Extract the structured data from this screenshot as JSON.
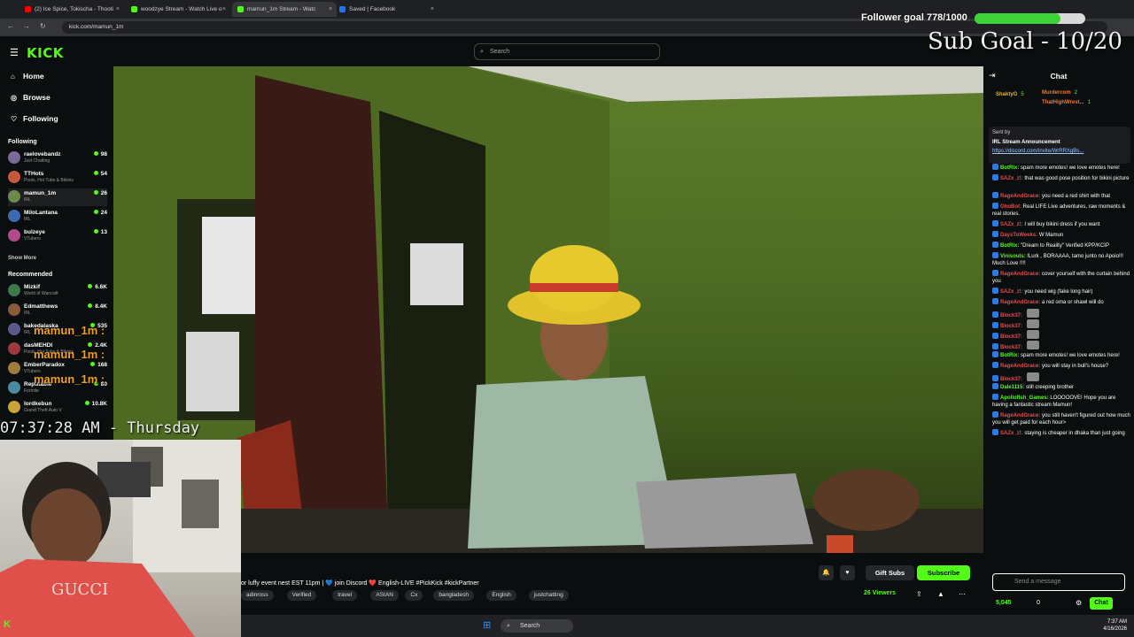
{
  "browser": {
    "tabs": [
      {
        "label": "(2) Ice Spice, Tokischa - Thooti",
        "color": "#ff0000",
        "active": false
      },
      {
        "label": "woodzye Stream - Watch Live o",
        "color": "#53fc18",
        "active": false
      },
      {
        "label": "mamun_1m Stream - Watc",
        "color": "#53fc18",
        "active": true
      },
      {
        "label": "Saved | Facebook",
        "color": "#1877f2",
        "active": false
      }
    ],
    "url": "kick.com/mamun_1m"
  },
  "header": {
    "logo": "KICK",
    "search_placeholder": "Search"
  },
  "sidebar": {
    "nav": [
      {
        "label": "Home",
        "icon": "home-icon"
      },
      {
        "label": "Browse",
        "icon": "compass-icon"
      },
      {
        "label": "Following",
        "icon": "heart-icon"
      }
    ],
    "following_title": "Following",
    "following": [
      {
        "name": "raelovebandz",
        "category": "Just Chatting",
        "viewers": "98",
        "color": "#7a6a9a"
      },
      {
        "name": "TTHots",
        "category": "Pools, Hot Tubs & Bikinis",
        "viewers": "54",
        "color": "#c45a3a"
      },
      {
        "name": "mamun_1m",
        "category": "IRL",
        "viewers": "26",
        "color": "#6b8a4a"
      },
      {
        "name": "MiloLantana",
        "category": "IRL",
        "viewers": "24",
        "color": "#3a6ab0"
      },
      {
        "name": "bulzeye",
        "category": "VTubers",
        "viewers": "13",
        "color": "#b04a8a"
      }
    ],
    "show_more": "Show More",
    "recommended_title": "Recommended",
    "recommended": [
      {
        "name": "Mizkif",
        "category": "World of Warcraft",
        "viewers": "6.6K",
        "color": "#3a7a4a"
      },
      {
        "name": "Edmatthews",
        "category": "IRL",
        "viewers": "8.4K",
        "color": "#8a5a3a"
      },
      {
        "name": "bakedalaska",
        "category": "IRL",
        "viewers": "535",
        "color": "#5a5a8a"
      },
      {
        "name": "dasMEHDI",
        "category": "Pools, Hot Tubs & Bikinis",
        "viewers": "2.4K",
        "color": "#9a3a3a"
      },
      {
        "name": "EmberParadox",
        "category": "VTubers",
        "viewers": "168",
        "color": "#a07a3a"
      },
      {
        "name": "Reputable",
        "category": "Fortnite",
        "viewers": "80",
        "color": "#4a8aa0"
      },
      {
        "name": "lordkebun",
        "category": "Grand Theft Auto V",
        "viewers": "10.8K",
        "color": "#c8a23a"
      }
    ]
  },
  "overlay": {
    "follower_goal": "Follower goal 778/1000",
    "follower_progress": 0.778,
    "sub_goal": "Sub Goal - 10/20",
    "clock": "07:37:28 AM - Thursday",
    "names": [
      "mamun_1m :",
      "mamun_1m :",
      "mamun_1m :"
    ]
  },
  "stream": {
    "title": "or luffy event nest EST 11pm | 💙 join Discord ❤️ English-LIVE #PickKick #kickPartner",
    "tags": [
      "adinross",
      "Verified",
      "travel",
      "ASIAN",
      "Cx",
      "bangladesh",
      "English",
      "justchatting"
    ],
    "gift_label": "Gift Subs",
    "subscribe_label": "Subscribe",
    "viewers": "26 Viewers"
  },
  "chat": {
    "title": "Chat",
    "top_gifters": [
      {
        "name": "ShaktyG",
        "count": "5"
      },
      {
        "name": "Murdercom",
        "count": "2"
      },
      {
        "name": "ThatHighWrest...",
        "count": "1"
      }
    ],
    "announcement": {
      "sender": "Sent by",
      "title": "IRL Stream Announcement",
      "link": "https://discord.com/invite/WrRRXgBs..."
    },
    "messages": [
      {
        "user": "BotRix:",
        "text": "spam more emotes! we love emotes here!",
        "color": "#53fc18"
      },
      {
        "user": "SAZx_z!:",
        "text": "that was good pose position for bikini picture",
        "color": "#e05050"
      },
      {
        "user": "RageAndGrace:",
        "text": "you need a red shirt with that",
        "color": "#e05050"
      },
      {
        "user": "GhoBot:",
        "text": "Real LIFE Live adventures, raw moments & real stories.",
        "color": "#e05050"
      },
      {
        "user": "SAZx_z!:",
        "text": "I will buy bikini dress if you want",
        "color": "#e05050"
      },
      {
        "user": "DaysToWeeks:",
        "text": "W Mamun",
        "color": "#e05050"
      },
      {
        "user": "BotRix:",
        "text": "\"Dream to Reality\" Verified KPP/KCIP",
        "color": "#53fc18"
      },
      {
        "user": "Vinisouls:",
        "text": "!Lurk , BORAAAA, tamo junto no Apoio!!! Much Love !!!!",
        "color": "#53fc18"
      },
      {
        "user": "RageAndGrace:",
        "text": "cover yourself with the curtain behind you",
        "color": "#e05050"
      },
      {
        "user": "SAZx_z!:",
        "text": "you need wig (fake long hair)",
        "color": "#e05050"
      },
      {
        "user": "RageAndGrace:",
        "text": "a red orna or shawl will do",
        "color": "#e05050"
      },
      {
        "user": "Block37:",
        "text": "",
        "color": "#e05050"
      },
      {
        "user": "Block37:",
        "text": "",
        "color": "#e05050"
      },
      {
        "user": "Block37:",
        "text": "",
        "color": "#e05050"
      },
      {
        "user": "Block37:",
        "text": "",
        "color": "#e05050"
      },
      {
        "user": "BotRix:",
        "text": "spam more emotes! we love emotes here!",
        "color": "#53fc18"
      },
      {
        "user": "RageAndGrace:",
        "text": "you will stay in bull's house?",
        "color": "#e05050"
      },
      {
        "user": "Block37:",
        "text": "",
        "color": "#e05050"
      },
      {
        "user": "Dale1115:",
        "text": "still creeping brother",
        "color": "#53fc18"
      },
      {
        "user": "Apollofish_Games:",
        "text": "LOOOOOVE! Hope you are having a fantastic stream Mamun!",
        "color": "#53fc18"
      },
      {
        "user": "RageAndGrace:",
        "text": "you still haven't figured out how much you will get paid for each hour>",
        "color": "#e05050"
      },
      {
        "user": "SAZx_z!:",
        "text": "staying is cheaper in dhaka than just going",
        "color": "#e05050"
      }
    ],
    "input_placeholder": "Send a message",
    "points": "5,045",
    "zero": "0",
    "send_label": "Chat"
  },
  "taskbar": {
    "search": "Search",
    "time": "7:37 AM",
    "date": "4/16/2026"
  }
}
